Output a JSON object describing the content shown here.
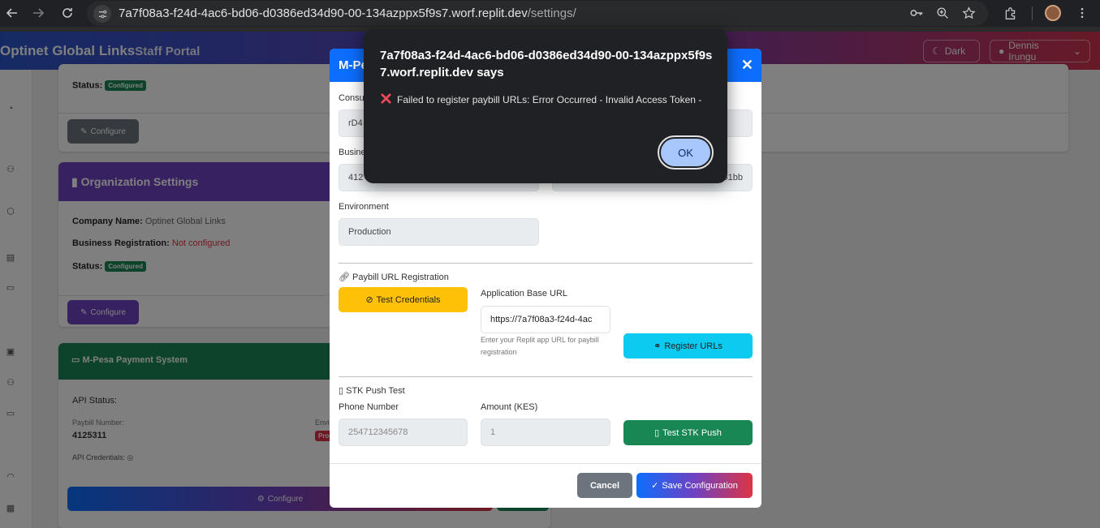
{
  "browser": {
    "url_host": "7a7f08a3-f24d-4ac6-bd06-d0386ed34d90-00-134azppx5f9s7.worf.replit.dev",
    "url_path": "/settings/"
  },
  "app": {
    "brand": "Optinet Global Links",
    "brand_sub": "Staff Portal",
    "theme_label": "Dark",
    "user_label": "Dennis Irungu"
  },
  "bg_cards": {
    "top_status_label": "Status:",
    "top_status_badge": "Configured",
    "top_configure": "Configure",
    "org_title": "Organization Settings",
    "company_label": "Company Name:",
    "company_value": "Optinet Global Links",
    "bizreg_label": "Business Registration:",
    "bizreg_value": "Not configured",
    "org_status_label": "Status:",
    "org_status_badge": "Configured",
    "org_configure": "Configure",
    "mpesa_title": "M-Pesa Payment System",
    "api_status_label": "API Status:",
    "paybill_label": "Paybill Number:",
    "paybill_value": "4125311",
    "env_label_short": "Envi",
    "env_badge_short": "Pro",
    "api_creds_label": "API Credentials:",
    "mpesa_configure": "Configure"
  },
  "modal": {
    "title": "M-Pe",
    "consumer_label": "Consu",
    "consumer_value": "rD4",
    "business_label": "Busine",
    "business_value": "412",
    "passkey_tail": "51bb",
    "environment_label": "Environment",
    "environment_value": "Production",
    "paybill_section": "Paybill URL Registration",
    "test_credentials": "Test Credentials",
    "app_base_url_label": "Application Base URL",
    "app_base_url_value": "https://7a7f08a3-f24d-4ac",
    "app_base_url_help": "Enter your Replit app URL for paybill registration",
    "register_urls": "Register URLs",
    "stk_section": "STK Push Test",
    "phone_label": "Phone Number",
    "phone_placeholder": "254712345678",
    "amount_label": "Amount (KES)",
    "amount_placeholder": "1",
    "test_stk": "Test STK Push",
    "cancel": "Cancel",
    "save": "Save Configuration"
  },
  "alert": {
    "title": "7a7f08a3-f24d-4ac6-bd06-d0386ed34d90-00-134azppx5f9s7.worf.replit.dev says",
    "message": "Failed to register paybill URLs: Error Occurred - Invalid Access Token -",
    "ok": "OK"
  },
  "colors": {
    "primary": "#0d6efd",
    "warning": "#ffc107",
    "info": "#0dcaf0",
    "success": "#198754",
    "secondary": "#6c757d",
    "purple": "#6f42c1"
  }
}
